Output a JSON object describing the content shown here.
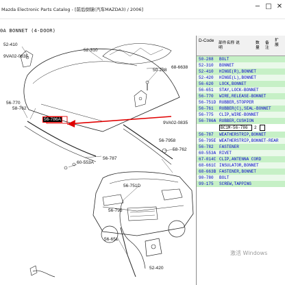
{
  "window": {
    "title": "Mazda Electronic Parts Catalog - [前后倒镜(汽车MAZDA3) / 2006]",
    "minimize_glyph": "−",
    "maximize_glyph": "□",
    "close_glyph": "✕"
  },
  "diagram": {
    "title": "0A BONNET (4-DOOR)",
    "callouts": {
      "c_52410": "52-410",
      "c_9va02": "9VA02-0835",
      "c_52310": "52-310",
      "c_50288": "50-288",
      "c_68663a": "68-6638",
      "c_56770": "56-770",
      "c_58762": "58-762",
      "c_56786a": "56-786A",
      "c_9va02b": "9VA02-0835",
      "c_567958": "56-7958",
      "c_58762b": "58-762",
      "c_56787": "56-787",
      "c_60553": "60-553A",
      "c_56751": "56-751D",
      "c_56795": "56-795",
      "c_56651": "56-651",
      "c_52420": "52-420"
    }
  },
  "parts_panel": {
    "headers": {
      "code": "D-Code",
      "name": "部件名称 说明",
      "qty": "数量",
      "note": "备注",
      "ext": "扩展"
    },
    "rows": [
      {
        "code": "50-288",
        "name": "BOLT"
      },
      {
        "code": "52-310",
        "name": "BONNET"
      },
      {
        "code": "52-410",
        "name": "HINGE(R),BONNET"
      },
      {
        "code": "52-420",
        "name": "HINGE(L),BONNET"
      },
      {
        "code": "56-620",
        "name": "LOCK,BONNET"
      },
      {
        "code": "56-651",
        "name": "STAY,LOCK-BONNET"
      },
      {
        "code": "56-770",
        "name": "WIRE,RELEASE-BONNET"
      },
      {
        "code": "56-751D",
        "name": "RUBBER,STOPPER"
      },
      {
        "code": "56-761",
        "name": "RUBBER(C),SEAL-BONNET"
      },
      {
        "code": "56-775",
        "name": "CLIP,WIRE-BONNET"
      },
      {
        "code": "56-786A",
        "name": "RUBBER,CUSHION"
      }
    ],
    "selected_row": {
      "part_number": "BC1M-56-786",
      "qty": "2"
    },
    "rows_after": [
      {
        "code": "56-787",
        "name": "WEATHERSTRIP,BONNET"
      },
      {
        "code": "56-795E",
        "name": "WEATHERSTRIP,BONNET-REAR"
      },
      {
        "code": "56-782",
        "name": "FASTENER"
      },
      {
        "code": "60-553A",
        "name": "RIVET"
      },
      {
        "code": "67-014C",
        "name": "CLIP,ANTENNA CORD"
      },
      {
        "code": "68-661C",
        "name": "INSULATOR,BONNET"
      },
      {
        "code": "68-663B",
        "name": "FASTENER,BONNET"
      },
      {
        "code": "90-780",
        "name": "BOLT"
      },
      {
        "code": "99-175",
        "name": "SCREW,TAPPING"
      }
    ]
  },
  "watermark": "激活 Windows",
  "colors": {
    "row_highlight": "#c6f0c6",
    "row_light": "#eaf9ea",
    "code_text": "#0000cc",
    "arrow": "#e00000"
  }
}
